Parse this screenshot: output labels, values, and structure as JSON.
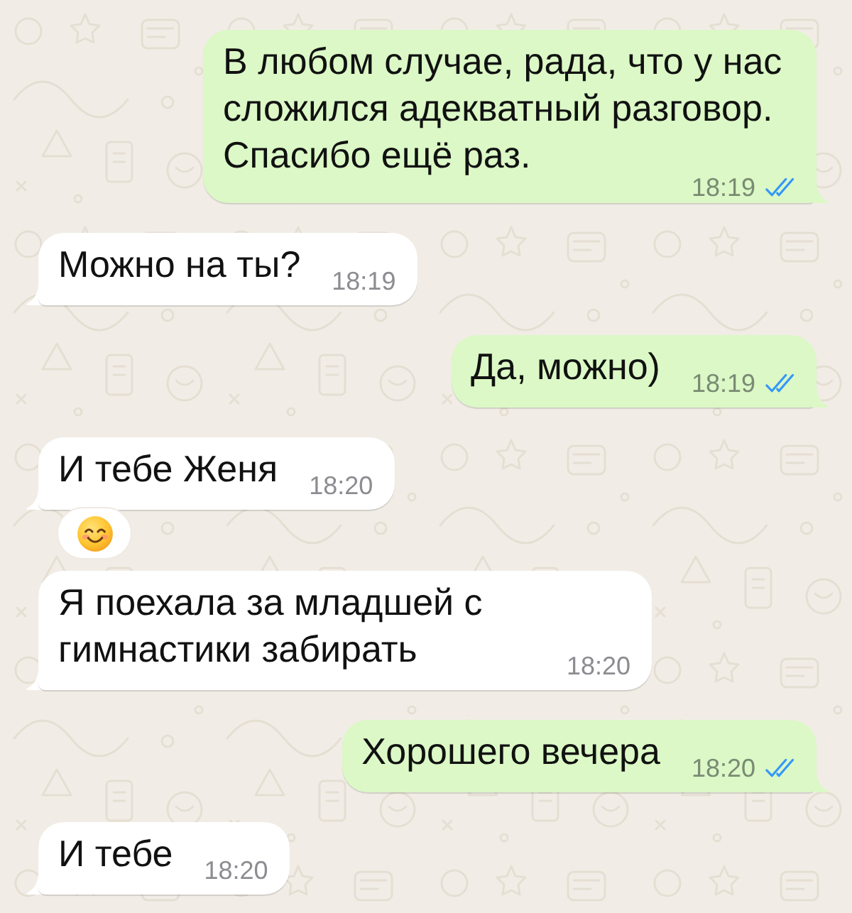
{
  "messages": [
    {
      "outgoing": true,
      "text": "В любом случае, рада, что у нас сложился адекватный разговор. Спасибо ещё раз.",
      "time": "18:19",
      "read": true
    },
    {
      "outgoing": false,
      "text": "Можно на ты?",
      "time": "18:19"
    },
    {
      "outgoing": true,
      "text": "Да, можно)",
      "time": "18:19",
      "read": true
    },
    {
      "outgoing": false,
      "text": "И тебе Женя",
      "time": "18:20",
      "reacted": true
    },
    {
      "outgoing": false,
      "text": "Я поехала за младшей с гимнастики забирать",
      "time": "18:20"
    },
    {
      "outgoing": true,
      "text": "Хорошего вечера",
      "time": "18:20",
      "read": true
    },
    {
      "outgoing": false,
      "text": "И тебе",
      "time": "18:20"
    }
  ]
}
